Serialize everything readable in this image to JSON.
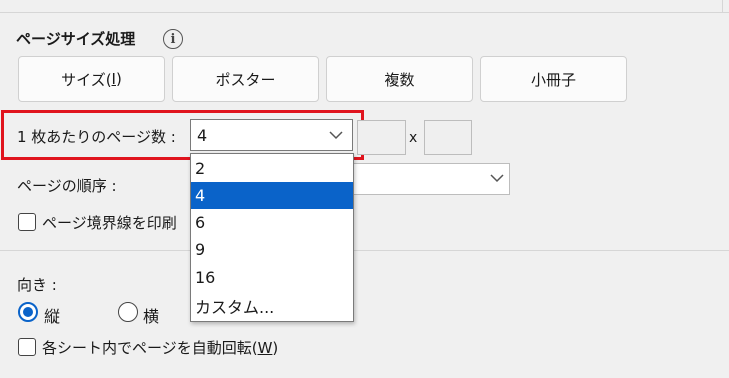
{
  "section": {
    "title": "ページサイズ処理",
    "info_icon": "info-icon"
  },
  "tabs": [
    {
      "label": "サイズ(",
      "accel": "I",
      "suffix": ")"
    },
    {
      "label": "ポスター"
    },
    {
      "label": "複数"
    },
    {
      "label": "小冊子"
    }
  ],
  "pages_per_sheet": {
    "label": "1 枚あたりのページ数 :",
    "value": "4",
    "x_label": "x",
    "options": [
      "2",
      "4",
      "6",
      "9",
      "16",
      "カスタム..."
    ],
    "selected_index": 1
  },
  "page_order": {
    "label": "ページの順序 :"
  },
  "page_border": {
    "label": "ページ境界線を印刷",
    "checked": false
  },
  "orientation": {
    "label": "向き :",
    "options": [
      {
        "label": "縦",
        "selected": true
      },
      {
        "label": "横",
        "selected": false
      }
    ]
  },
  "auto_rotate": {
    "label": "各シート内でページを自動回転(",
    "accel": "W",
    "suffix": ")",
    "checked": false
  },
  "colors": {
    "accent": "#0a63c9",
    "highlight_border": "#e0141e"
  }
}
